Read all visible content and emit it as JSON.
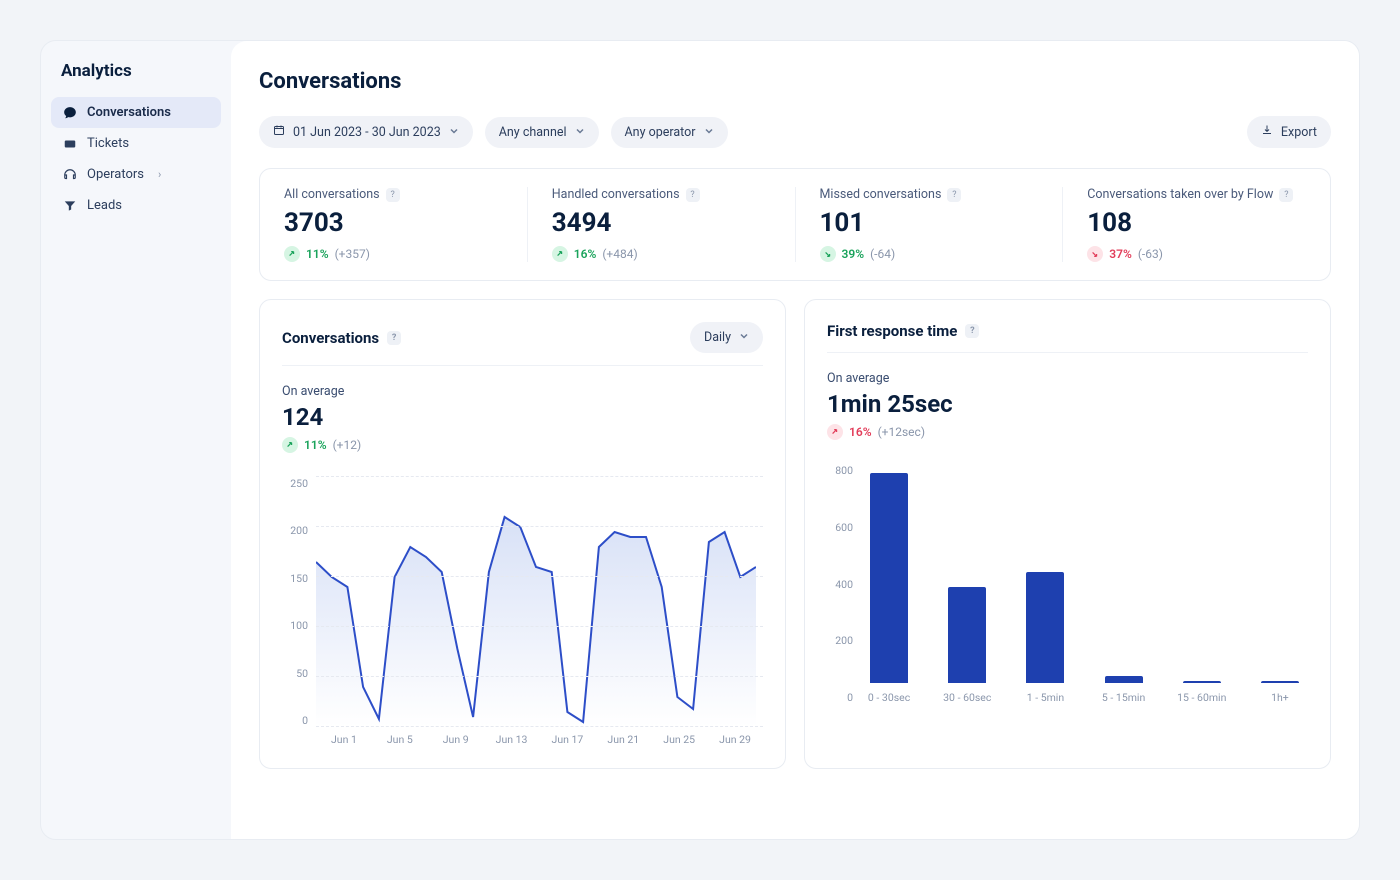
{
  "sidebar": {
    "title": "Analytics",
    "items": [
      {
        "label": "Conversations",
        "icon": "chat"
      },
      {
        "label": "Tickets",
        "icon": "ticket"
      },
      {
        "label": "Operators",
        "icon": "operators",
        "expandable": true
      },
      {
        "label": "Leads",
        "icon": "funnel"
      }
    ]
  },
  "page": {
    "title": "Conversations"
  },
  "filters": {
    "date_range": "01 Jun 2023 - 30 Jun 2023",
    "channel": "Any channel",
    "operator": "Any operator",
    "export_label": "Export"
  },
  "stats": [
    {
      "label": "All conversations",
      "value": "3703",
      "pct": "11%",
      "abs": "(+357)",
      "direction": "up",
      "sentiment": "green"
    },
    {
      "label": "Handled conversations",
      "value": "3494",
      "pct": "16%",
      "abs": "(+484)",
      "direction": "up",
      "sentiment": "green"
    },
    {
      "label": "Missed conversations",
      "value": "101",
      "pct": "39%",
      "abs": "(-64)",
      "direction": "down",
      "sentiment": "green"
    },
    {
      "label": "Conversations taken over by Flow",
      "value": "108",
      "pct": "37%",
      "abs": "(-63)",
      "direction": "down",
      "sentiment": "red"
    }
  ],
  "conversations_chart": {
    "title": "Conversations",
    "granularity": "Daily",
    "avg_label": "On average",
    "avg_value": "124",
    "avg_pct": "11%",
    "avg_abs": "(+12)"
  },
  "response_chart": {
    "title": "First response time",
    "avg_label": "On average",
    "avg_value": "1min 25sec",
    "avg_pct": "16%",
    "avg_abs": "(+12sec)"
  },
  "chart_data": [
    {
      "type": "line",
      "title": "Conversations (Daily)",
      "xlabel": "",
      "ylabel": "",
      "ylim": [
        0,
        250
      ],
      "x_ticks": [
        "Jun 1",
        "Jun 5",
        "Jun 9",
        "Jun 13",
        "Jun 17",
        "Jun 21",
        "Jun 25",
        "Jun 29"
      ],
      "y_ticks": [
        0,
        50,
        100,
        150,
        200,
        250
      ],
      "x": [
        "Jun 1",
        "Jun 2",
        "Jun 3",
        "Jun 4",
        "Jun 5",
        "Jun 6",
        "Jun 7",
        "Jun 8",
        "Jun 9",
        "Jun 10",
        "Jun 11",
        "Jun 12",
        "Jun 13",
        "Jun 14",
        "Jun 15",
        "Jun 16",
        "Jun 17",
        "Jun 18",
        "Jun 19",
        "Jun 20",
        "Jun 21",
        "Jun 22",
        "Jun 23",
        "Jun 24",
        "Jun 25",
        "Jun 26",
        "Jun 27",
        "Jun 28",
        "Jun 29"
      ],
      "values": [
        165,
        150,
        140,
        40,
        8,
        150,
        180,
        170,
        155,
        78,
        10,
        155,
        210,
        200,
        160,
        155,
        15,
        5,
        180,
        195,
        190,
        190,
        140,
        30,
        18,
        185,
        195,
        150,
        160
      ]
    },
    {
      "type": "bar",
      "title": "First response time",
      "xlabel": "",
      "ylabel": "",
      "ylim": [
        0,
        800
      ],
      "y_ticks": [
        0,
        200,
        400,
        600,
        800
      ],
      "categories": [
        "0 - 30sec",
        "30 - 60sec",
        "1 - 5min",
        "5 - 15min",
        "15 - 60min",
        "1h+"
      ],
      "values": [
        700,
        320,
        370,
        25,
        8,
        8
      ]
    }
  ]
}
